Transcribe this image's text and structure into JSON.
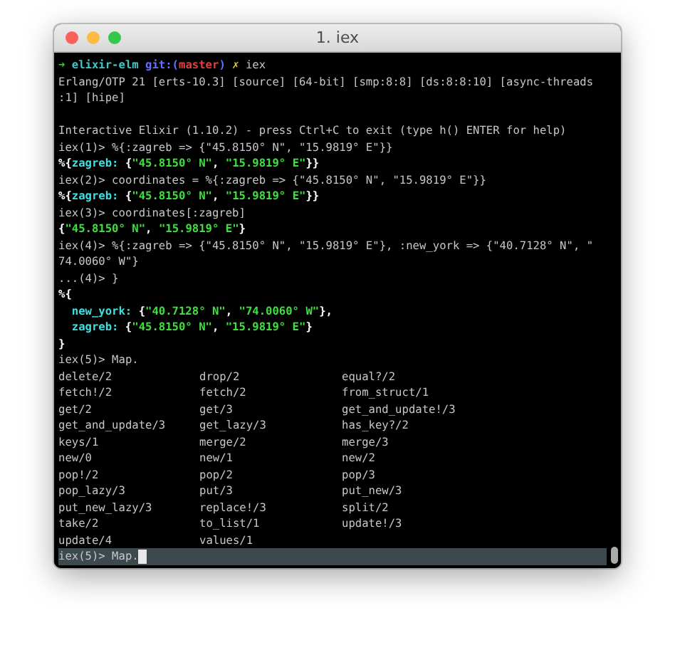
{
  "window": {
    "title": "1. iex",
    "buttons": [
      {
        "color": "#fc605c"
      },
      {
        "color": "#fdbc40"
      },
      {
        "color": "#34c84a"
      }
    ]
  },
  "lines": [
    {
      "kind": "text",
      "segments": [
        {
          "text": "➜ ",
          "kind": "arrow"
        },
        {
          "text": "elixir-elm ",
          "kind": "dir"
        },
        {
          "text": "git:(",
          "kind": "git"
        },
        {
          "text": "master",
          "kind": "branch"
        },
        {
          "text": ") ",
          "kind": "git"
        },
        {
          "text": "✗ ",
          "kind": "dirty"
        },
        {
          "text": "iex",
          "kind": "plain"
        }
      ]
    },
    {
      "kind": "text",
      "segments": [
        {
          "text": "Erlang/OTP 21 [erts-10.3] [source] [64-bit] [smp:8:8] [ds:8:8:10] [async-threads",
          "kind": "plain"
        }
      ]
    },
    {
      "kind": "text",
      "segments": [
        {
          "text": ":1] [hipe]",
          "kind": "plain"
        }
      ]
    },
    {
      "kind": "blank"
    },
    {
      "kind": "text",
      "segments": [
        {
          "text": "Interactive Elixir (1.10.2) - press Ctrl+C to exit (type h() ENTER for help)",
          "kind": "plain"
        }
      ]
    },
    {
      "kind": "text",
      "segments": [
        {
          "text": "iex(1)> %{:zagreb => {\"45.8150° N\", \"15.9819° E\"}}",
          "kind": "plain"
        }
      ]
    },
    {
      "kind": "text",
      "segments": [
        {
          "text": "%{",
          "kind": "bold"
        },
        {
          "text": "zagreb:",
          "kind": "key"
        },
        {
          "text": " {",
          "kind": "bold"
        },
        {
          "text": "\"45.8150° N\"",
          "kind": "string"
        },
        {
          "text": ", ",
          "kind": "bold"
        },
        {
          "text": "\"15.9819° E\"",
          "kind": "string"
        },
        {
          "text": "}}",
          "kind": "bold"
        }
      ]
    },
    {
      "kind": "text",
      "segments": [
        {
          "text": "iex(2)> coordinates = %{:zagreb => {\"45.8150° N\", \"15.9819° E\"}}",
          "kind": "plain"
        }
      ]
    },
    {
      "kind": "text",
      "segments": [
        {
          "text": "%{",
          "kind": "bold"
        },
        {
          "text": "zagreb:",
          "kind": "key"
        },
        {
          "text": " {",
          "kind": "bold"
        },
        {
          "text": "\"45.8150° N\"",
          "kind": "string"
        },
        {
          "text": ", ",
          "kind": "bold"
        },
        {
          "text": "\"15.9819° E\"",
          "kind": "string"
        },
        {
          "text": "}}",
          "kind": "bold"
        }
      ]
    },
    {
      "kind": "text",
      "segments": [
        {
          "text": "iex(3)> coordinates[:zagreb]",
          "kind": "plain"
        }
      ]
    },
    {
      "kind": "text",
      "segments": [
        {
          "text": "{",
          "kind": "bold"
        },
        {
          "text": "\"45.8150° N\"",
          "kind": "string"
        },
        {
          "text": ", ",
          "kind": "bold"
        },
        {
          "text": "\"15.9819° E\"",
          "kind": "string"
        },
        {
          "text": "}",
          "kind": "bold"
        }
      ]
    },
    {
      "kind": "text",
      "segments": [
        {
          "text": "iex(4)> %{:zagreb => {\"45.8150° N\", \"15.9819° E\"}, :new_york => {\"40.7128° N\", \"",
          "kind": "plain"
        }
      ]
    },
    {
      "kind": "text",
      "segments": [
        {
          "text": "74.0060° W\"}",
          "kind": "plain"
        }
      ]
    },
    {
      "kind": "text",
      "segments": [
        {
          "text": "...(4)> }",
          "kind": "plain"
        }
      ]
    },
    {
      "kind": "text",
      "segments": [
        {
          "text": "%{",
          "kind": "bold"
        }
      ]
    },
    {
      "kind": "indented",
      "segments": [
        {
          "text": "new_york:",
          "kind": "key"
        },
        {
          "text": " {",
          "kind": "bold"
        },
        {
          "text": "\"40.7128° N\"",
          "kind": "string"
        },
        {
          "text": ", ",
          "kind": "bold"
        },
        {
          "text": "\"74.0060° W\"",
          "kind": "string"
        },
        {
          "text": "},",
          "kind": "bold"
        }
      ]
    },
    {
      "kind": "indented",
      "segments": [
        {
          "text": "zagreb:",
          "kind": "key"
        },
        {
          "text": " {",
          "kind": "bold"
        },
        {
          "text": "\"45.8150° N\"",
          "kind": "string"
        },
        {
          "text": ", ",
          "kind": "bold"
        },
        {
          "text": "\"15.9819° E\"",
          "kind": "string"
        },
        {
          "text": "}",
          "kind": "bold"
        }
      ]
    },
    {
      "kind": "text",
      "segments": [
        {
          "text": "}",
          "kind": "bold"
        }
      ]
    },
    {
      "kind": "text",
      "segments": [
        {
          "text": "iex(5)> Map.",
          "kind": "plain"
        }
      ]
    }
  ],
  "completions": [
    "delete/2",
    "drop/2",
    "equal?/2",
    "fetch!/2",
    "fetch/2",
    "from_struct/1",
    "get/2",
    "get/3",
    "get_and_update!/3",
    "get_and_update/3",
    "get_lazy/3",
    "has_key?/2",
    "keys/1",
    "merge/2",
    "merge/3",
    "new/0",
    "new/1",
    "new/2",
    "pop!/2",
    "pop/2",
    "pop/3",
    "pop_lazy/3",
    "put/3",
    "put_new/3",
    "put_new_lazy/3",
    "replace!/3",
    "split/2",
    "take/2",
    "to_list/1",
    "update!/3",
    "update/4",
    "values/1"
  ],
  "input_line": {
    "text": "iex(5)> Map."
  }
}
